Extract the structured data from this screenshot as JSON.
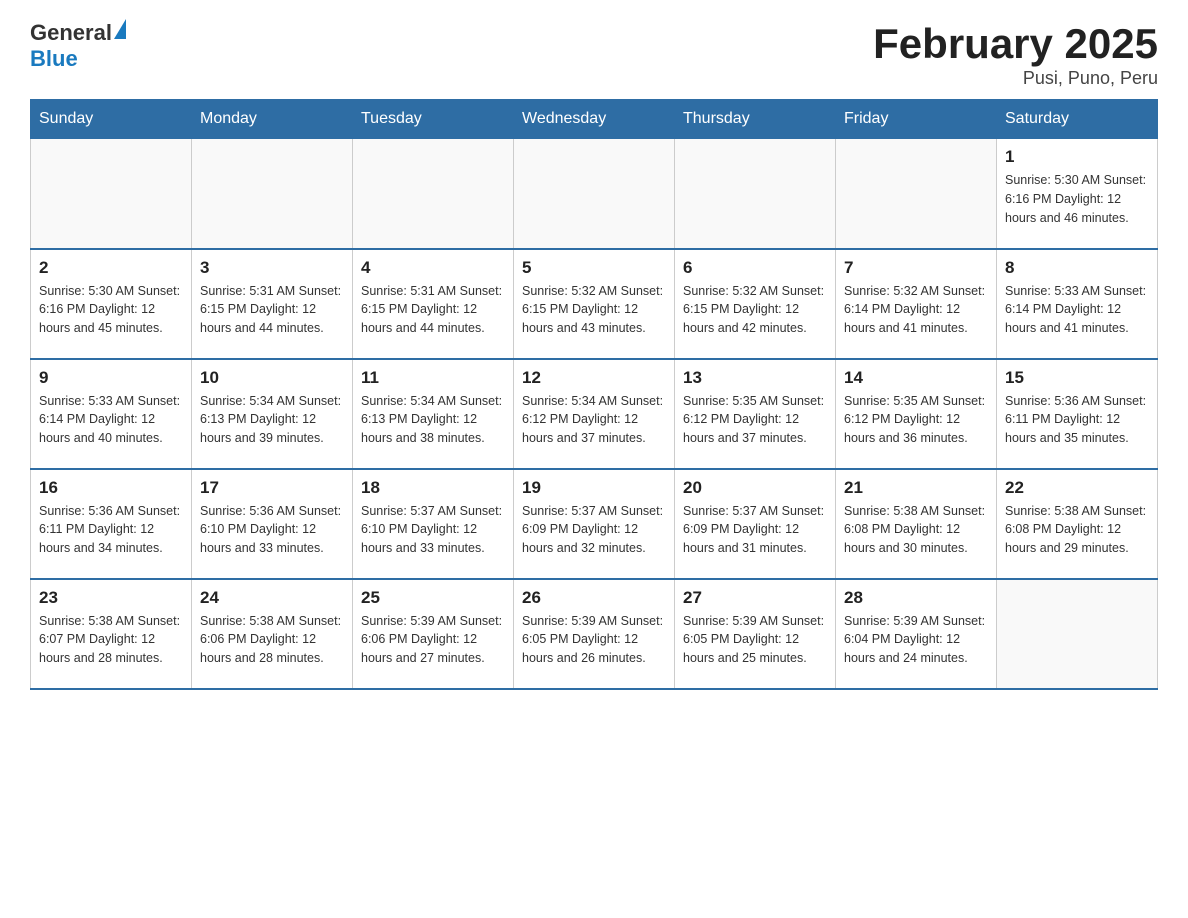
{
  "header": {
    "logo_general": "General",
    "logo_blue": "Blue",
    "title": "February 2025",
    "location": "Pusi, Puno, Peru"
  },
  "weekdays": [
    "Sunday",
    "Monday",
    "Tuesday",
    "Wednesday",
    "Thursday",
    "Friday",
    "Saturday"
  ],
  "weeks": [
    [
      {
        "day": "",
        "info": ""
      },
      {
        "day": "",
        "info": ""
      },
      {
        "day": "",
        "info": ""
      },
      {
        "day": "",
        "info": ""
      },
      {
        "day": "",
        "info": ""
      },
      {
        "day": "",
        "info": ""
      },
      {
        "day": "1",
        "info": "Sunrise: 5:30 AM\nSunset: 6:16 PM\nDaylight: 12 hours\nand 46 minutes."
      }
    ],
    [
      {
        "day": "2",
        "info": "Sunrise: 5:30 AM\nSunset: 6:16 PM\nDaylight: 12 hours\nand 45 minutes."
      },
      {
        "day": "3",
        "info": "Sunrise: 5:31 AM\nSunset: 6:15 PM\nDaylight: 12 hours\nand 44 minutes."
      },
      {
        "day": "4",
        "info": "Sunrise: 5:31 AM\nSunset: 6:15 PM\nDaylight: 12 hours\nand 44 minutes."
      },
      {
        "day": "5",
        "info": "Sunrise: 5:32 AM\nSunset: 6:15 PM\nDaylight: 12 hours\nand 43 minutes."
      },
      {
        "day": "6",
        "info": "Sunrise: 5:32 AM\nSunset: 6:15 PM\nDaylight: 12 hours\nand 42 minutes."
      },
      {
        "day": "7",
        "info": "Sunrise: 5:32 AM\nSunset: 6:14 PM\nDaylight: 12 hours\nand 41 minutes."
      },
      {
        "day": "8",
        "info": "Sunrise: 5:33 AM\nSunset: 6:14 PM\nDaylight: 12 hours\nand 41 minutes."
      }
    ],
    [
      {
        "day": "9",
        "info": "Sunrise: 5:33 AM\nSunset: 6:14 PM\nDaylight: 12 hours\nand 40 minutes."
      },
      {
        "day": "10",
        "info": "Sunrise: 5:34 AM\nSunset: 6:13 PM\nDaylight: 12 hours\nand 39 minutes."
      },
      {
        "day": "11",
        "info": "Sunrise: 5:34 AM\nSunset: 6:13 PM\nDaylight: 12 hours\nand 38 minutes."
      },
      {
        "day": "12",
        "info": "Sunrise: 5:34 AM\nSunset: 6:12 PM\nDaylight: 12 hours\nand 37 minutes."
      },
      {
        "day": "13",
        "info": "Sunrise: 5:35 AM\nSunset: 6:12 PM\nDaylight: 12 hours\nand 37 minutes."
      },
      {
        "day": "14",
        "info": "Sunrise: 5:35 AM\nSunset: 6:12 PM\nDaylight: 12 hours\nand 36 minutes."
      },
      {
        "day": "15",
        "info": "Sunrise: 5:36 AM\nSunset: 6:11 PM\nDaylight: 12 hours\nand 35 minutes."
      }
    ],
    [
      {
        "day": "16",
        "info": "Sunrise: 5:36 AM\nSunset: 6:11 PM\nDaylight: 12 hours\nand 34 minutes."
      },
      {
        "day": "17",
        "info": "Sunrise: 5:36 AM\nSunset: 6:10 PM\nDaylight: 12 hours\nand 33 minutes."
      },
      {
        "day": "18",
        "info": "Sunrise: 5:37 AM\nSunset: 6:10 PM\nDaylight: 12 hours\nand 33 minutes."
      },
      {
        "day": "19",
        "info": "Sunrise: 5:37 AM\nSunset: 6:09 PM\nDaylight: 12 hours\nand 32 minutes."
      },
      {
        "day": "20",
        "info": "Sunrise: 5:37 AM\nSunset: 6:09 PM\nDaylight: 12 hours\nand 31 minutes."
      },
      {
        "day": "21",
        "info": "Sunrise: 5:38 AM\nSunset: 6:08 PM\nDaylight: 12 hours\nand 30 minutes."
      },
      {
        "day": "22",
        "info": "Sunrise: 5:38 AM\nSunset: 6:08 PM\nDaylight: 12 hours\nand 29 minutes."
      }
    ],
    [
      {
        "day": "23",
        "info": "Sunrise: 5:38 AM\nSunset: 6:07 PM\nDaylight: 12 hours\nand 28 minutes."
      },
      {
        "day": "24",
        "info": "Sunrise: 5:38 AM\nSunset: 6:06 PM\nDaylight: 12 hours\nand 28 minutes."
      },
      {
        "day": "25",
        "info": "Sunrise: 5:39 AM\nSunset: 6:06 PM\nDaylight: 12 hours\nand 27 minutes."
      },
      {
        "day": "26",
        "info": "Sunrise: 5:39 AM\nSunset: 6:05 PM\nDaylight: 12 hours\nand 26 minutes."
      },
      {
        "day": "27",
        "info": "Sunrise: 5:39 AM\nSunset: 6:05 PM\nDaylight: 12 hours\nand 25 minutes."
      },
      {
        "day": "28",
        "info": "Sunrise: 5:39 AM\nSunset: 6:04 PM\nDaylight: 12 hours\nand 24 minutes."
      },
      {
        "day": "",
        "info": ""
      }
    ]
  ]
}
